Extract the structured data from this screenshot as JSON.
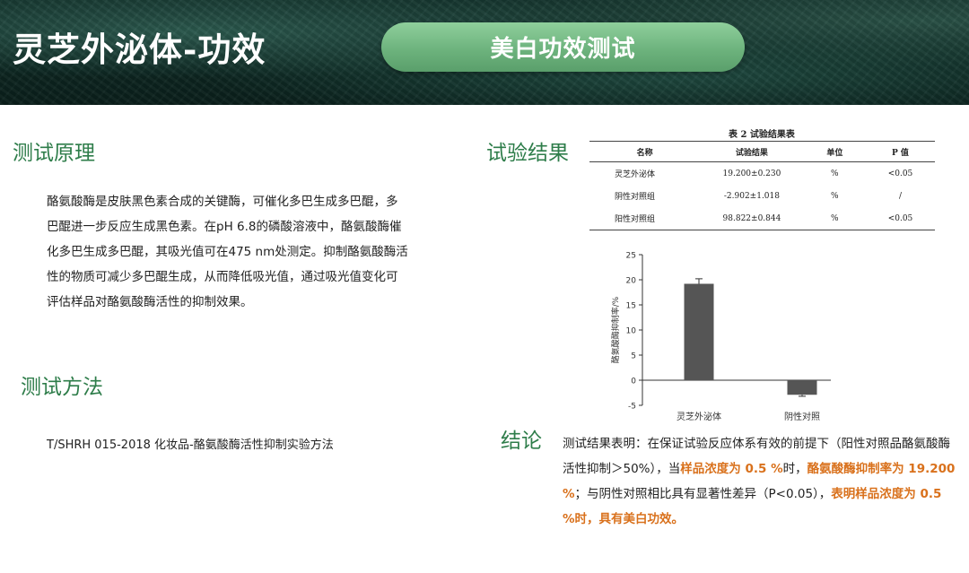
{
  "header": {
    "title": "灵芝外泌体-功效",
    "pill_label": "美白功效测试"
  },
  "principle": {
    "heading": "测试原理",
    "lines": [
      "酪氨酸酶是皮肤黑色素合成的关键酶，可催化多巴生成多巴醌，多",
      "巴醌进一步反应生成黑色素。在pH 6.8的磷酸溶液中，酪氨酸酶催",
      "化多巴生成多巴醌，其吸光值可在475 nm处测定。抑制酪氨酸酶活",
      "性的物质可减少多巴醌生成，从而降低吸光值，通过吸光值变化可",
      "评估样品对酪氨酸酶活性的抑制效果。"
    ]
  },
  "method": {
    "heading": "测试方法",
    "text": "T/SHRH 015-2018 化妆品-酪氨酸酶活性抑制实验方法"
  },
  "results": {
    "heading": "试验结果",
    "table_caption": "表 2  试验结果表",
    "columns": [
      "名称",
      "试验结果",
      "单位",
      "P 值"
    ],
    "rows": [
      [
        "灵芝外泌体",
        "19.200±0.230",
        "%",
        "<0.05"
      ],
      [
        "阴性对照组",
        "-2.902±1.018",
        "%",
        "/"
      ],
      [
        "阳性对照组",
        "98.822±0.844",
        "%",
        "<0.05"
      ]
    ]
  },
  "conclusion": {
    "heading": "结论",
    "part1": "测试结果表明：在保证试验反应体系有效的前提下（阳性对照品酪氨酸酶活性抑制＞50%），当",
    "hl1": "样品浓度为 0.5 %",
    "part2": "时，",
    "hl2": "酪氨酸酶抑制率为 19.200 %",
    "part3": "；与阴性对照相比具有显著性差异（P<0.05），",
    "hl3": "表明样品浓度为 0.5 %时，具有美白功效。",
    "highlight_color": "#d9711c"
  },
  "chart_data": {
    "type": "bar",
    "categories": [
      "灵芝外泌体",
      "阴性对照"
    ],
    "values": [
      19.2,
      -2.9
    ],
    "errors": [
      1.0,
      0.3
    ],
    "ylabel": "酪氨酸酶抑制率/%",
    "ylim": [
      -5,
      25
    ],
    "yticks": [
      -5,
      0,
      5,
      10,
      15,
      20,
      25
    ],
    "bar_color": "#555555",
    "grid": false
  }
}
